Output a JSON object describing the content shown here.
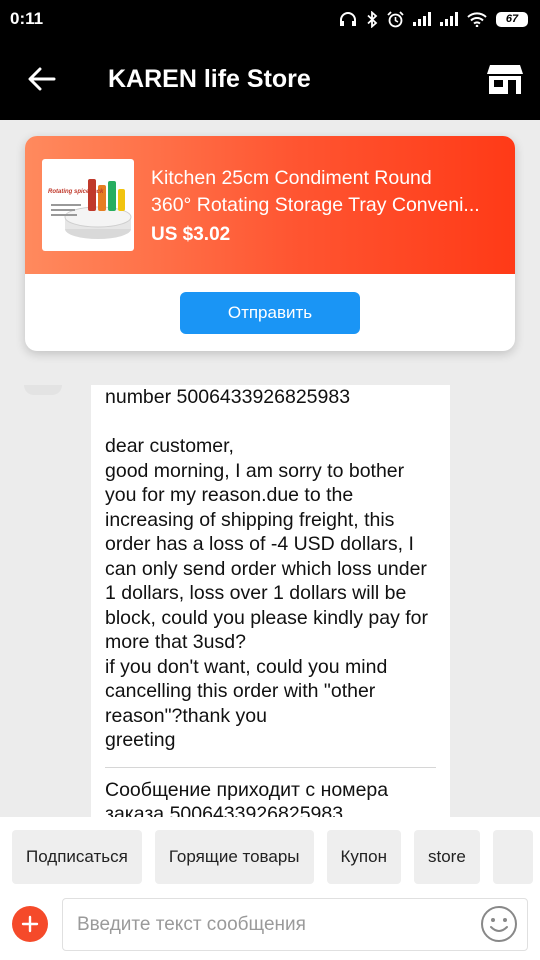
{
  "status_bar": {
    "time": "0:11",
    "battery": "67"
  },
  "header": {
    "title": "KAREN life Store"
  },
  "product_card": {
    "title_line1": "Kitchen 25cm Condiment Round",
    "title_line2": "360° Rotating Storage Tray Conveni...",
    "price": "US $3.02",
    "send_label": "Отправить",
    "image_caption": "Rotating spice rack"
  },
  "message": {
    "top_line": "number 5006433926825983",
    "body": "dear customer,\ngood morning, I am sorry to bother you for my reason.due to the increasing of shipping freight, this order has a loss of -4 USD dollars, I can only send order which loss under 1 dollars, loss over 1 dollars will be block, could you please kindly pay for more that 3usd?\nif you don't want, could you mind cancelling this order with \"other reason\"?thank you\ngreeting",
    "translation_note": "Сообщение приходит с номера заказа 5006433926825983"
  },
  "quick_replies": [
    "Подписаться",
    "Горящие товары",
    "Купон",
    "store"
  ],
  "composer": {
    "placeholder": "Введите текст сообщения"
  },
  "colors": {
    "accent_blue": "#1a95f5",
    "accent_orange": "#ff5531",
    "plus_red": "#f54a2a"
  }
}
